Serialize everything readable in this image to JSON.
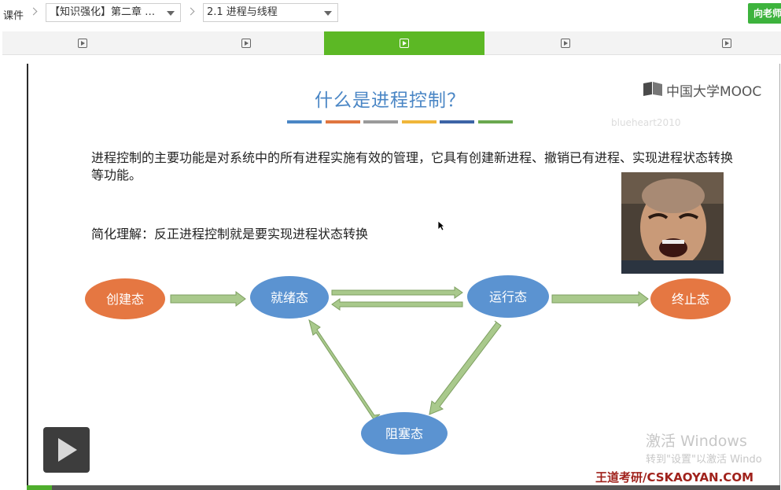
{
  "breadcrumb": {
    "root": "课件",
    "chapter": "【知识强化】第二章 …",
    "lesson": "2.1 进程与线程"
  },
  "ask_button": "向老师",
  "tabs": [
    {
      "name": "tab-1",
      "active": false
    },
    {
      "name": "tab-2",
      "active": false
    },
    {
      "name": "tab-3",
      "active": true
    },
    {
      "name": "tab-4",
      "active": false
    },
    {
      "name": "tab-5",
      "active": false
    }
  ],
  "slide": {
    "title": "什么是进程控制？",
    "color_bars": [
      "#4a86c5",
      "#e0763f",
      "#9a9a9a",
      "#f0b63a",
      "#3c64a6",
      "#6aa84f"
    ],
    "logo_text": "中国大学MOOC",
    "user_watermark": "blueheart2010",
    "paragraph": "进程控制的主要功能是对系统中的所有进程实施有效的管理，它具有创建新进程、撤销已有进程、实现进程状态转换等功能。",
    "simplified": "简化理解：反正进程控制就是要实现进程状态转换",
    "states": {
      "create": "创建态",
      "ready": "就绪态",
      "running": "运行态",
      "terminate": "终止态",
      "blocked": "阻塞态"
    },
    "colors": {
      "orange_state": "#e57742",
      "blue_state": "#5b93d1",
      "arrow_fill": "#a9c98c",
      "arrow_stroke": "#7d9f60"
    }
  },
  "windows_watermark": {
    "title": "激活 Windows",
    "subtitle": "转到\"设置\"以激活 Windo"
  },
  "brand": "王道考研/CSKAOYAN.COM"
}
